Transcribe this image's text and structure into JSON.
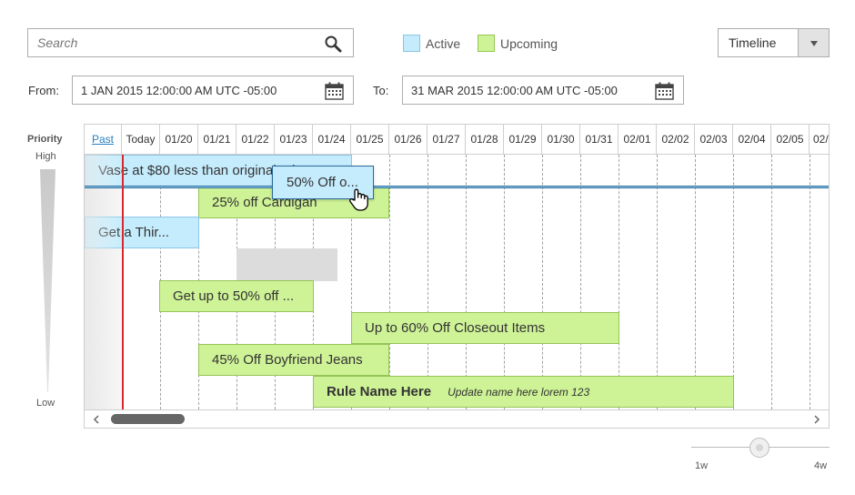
{
  "search": {
    "placeholder": "Search",
    "value": ""
  },
  "legend": [
    {
      "label": "Active",
      "color": "#c5ecfd"
    },
    {
      "label": "Upcoming",
      "color": "#cef296"
    }
  ],
  "view_select": {
    "selected": "Timeline"
  },
  "date_range": {
    "from_label": "From:",
    "from_value": "1 JAN 2015 12:00:00 AM UTC -05:00",
    "to_label": "To:",
    "to_value": "31 MAR 2015 12:00:00 AM UTC -05:00"
  },
  "priority": {
    "title": "Priority",
    "high": "High",
    "low": "Low"
  },
  "timeline": {
    "columns": [
      "Past",
      "Today",
      "01/20",
      "01/21",
      "01/22",
      "01/23",
      "01/24",
      "01/25",
      "01/26",
      "01/27",
      "01/28",
      "01/29",
      "01/30",
      "01/31",
      "02/01",
      "02/02",
      "02/03",
      "02/04",
      "02/05",
      "02/0"
    ],
    "rules": [
      {
        "label": "Vase at $80 less than original price",
        "status": "active"
      },
      {
        "label": "25% off Cardigan",
        "status": "upcoming"
      },
      {
        "label": "Get a Thir...",
        "status": "active"
      },
      {
        "label": "Get up to 50% off ...",
        "status": "upcoming"
      },
      {
        "label": "Up to 60% Off Closeout Items",
        "status": "upcoming"
      },
      {
        "label": "45% Off Boyfriend Jeans",
        "status": "upcoming"
      },
      {
        "label": "Rule Name Here",
        "note": "Update name here lorem 123",
        "status": "upcoming"
      }
    ],
    "dragging_label": "50% Off o..."
  },
  "zoom": {
    "min_label": "1w",
    "max_label": "4w",
    "level": 0.5
  },
  "colors": {
    "active": "#c5ecfd",
    "upcoming": "#cef296",
    "today_line": "#d9272e",
    "selected_row": "#2b6a9b"
  }
}
